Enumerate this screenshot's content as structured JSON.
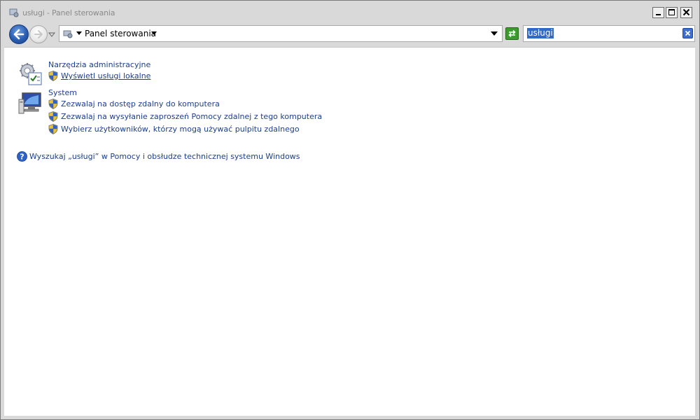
{
  "window": {
    "title": "usługi - Panel sterowania"
  },
  "toolbar": {
    "breadcrumb": "Panel sterowania",
    "search_value": "usługi"
  },
  "content": {
    "groups": [
      {
        "title": "Narzędzia administracyjne",
        "icon": "admin-tools-icon",
        "tasks": [
          {
            "label": "Wyświetl usługi lokalne",
            "underlined": true
          }
        ]
      },
      {
        "title": "System",
        "icon": "system-computer-icon",
        "tasks": [
          {
            "label": "Zezwalaj na dostęp zdalny do komputera"
          },
          {
            "label": "Zezwalaj na wysyłanie zaproszeń Pomocy zdalnej z tego komputera"
          },
          {
            "label": "Wybierz użytkowników, którzy mogą używać pulpitu zdalnego"
          }
        ]
      }
    ],
    "help_link": "Wyszukaj „usługi” w Pomocy i obsłudze technicznej systemu Windows"
  },
  "colors": {
    "link": "#1b3f8b",
    "selection": "#3169c6",
    "refresh_green": "#3c9a2e"
  }
}
